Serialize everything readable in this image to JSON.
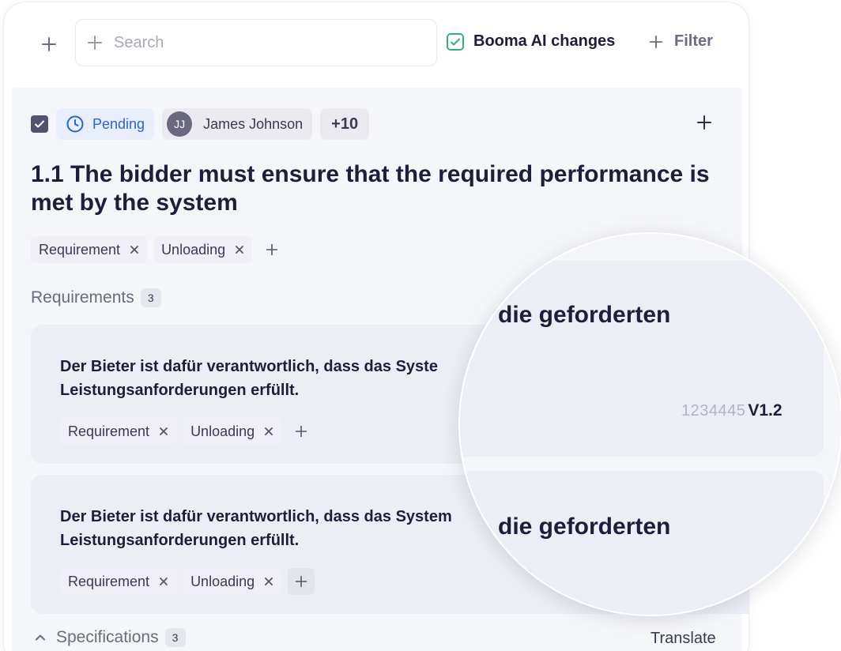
{
  "topbar": {
    "search_placeholder": "Search",
    "ai_changes_label": "Booma AI changes",
    "ai_changes_checked": true,
    "filter_label": "Filter"
  },
  "item": {
    "status": "Pending",
    "assignee": {
      "initials": "JJ",
      "name": "James Johnson"
    },
    "extra_assignees": "+10",
    "title": "1.1 The bidder must ensure that the required performance is met by the system",
    "tags": [
      "Requirement",
      "Unloading"
    ]
  },
  "requirements": {
    "label": "Requirements",
    "count": "3",
    "cards": [
      {
        "text_line1": "Der Bieter ist dafür verantwortlich, dass das Syste",
        "text_line2": "Leistungsanforderungen erfüllt.",
        "tags": [
          "Requirement",
          "Unloading"
        ]
      },
      {
        "text_line1": "Der Bieter ist dafür verantwortlich, dass das System",
        "text_line2": "Leistungsanforderungen erfüllt.",
        "tags": [
          "Requirement",
          "Unloading"
        ]
      }
    ]
  },
  "magnifier": {
    "text1": "die geforderten",
    "text2": "die geforderten",
    "version_number": "1234445",
    "version_label": "V1.2"
  },
  "specifications": {
    "label": "Specifications",
    "count": "3",
    "translate_label": "Translate"
  },
  "colors": {
    "accent_blue": "#2b63d9",
    "success_green": "#2fb37a",
    "text_dark": "#1f1d3a"
  }
}
